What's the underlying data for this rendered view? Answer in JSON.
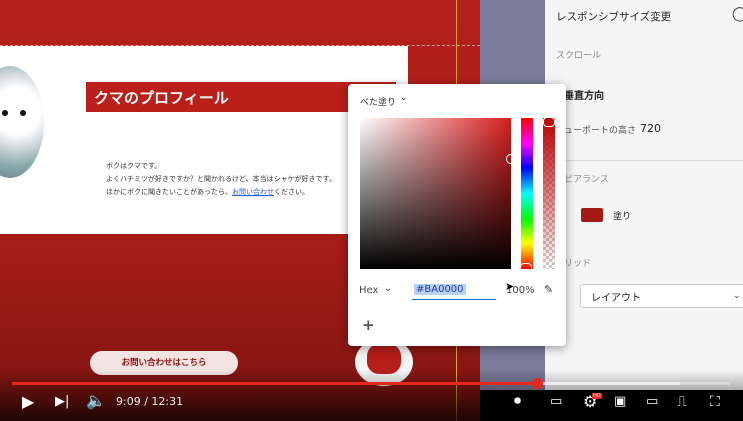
{
  "artboard": {
    "title": "クマのプロフィール",
    "body_lines": [
      "ボクはクマです。",
      "よくハチミツが好きですか？と聞かれるけど、本当はシャケが好きです。",
      "ほかにボクに聞きたいことがあったら、"
    ],
    "link_text": "お問い合わせ",
    "link_suffix": "ください。",
    "contact_button": "お問い合わせはこちら"
  },
  "panel": {
    "responsive_resize": "レスポンシブサイズ変更",
    "scroll_label": "スクロール",
    "scroll_value": "垂直方向",
    "viewport_label": "ューポートの高さ",
    "viewport_value": "720",
    "appearance_label": "ピアランス",
    "fill_label": "塗り",
    "grid_label": "リッド",
    "layout_label": "レイアウト"
  },
  "picker": {
    "fill_type": "べた塗り",
    "mode": "Hex",
    "hex": "#BA0000",
    "opacity_text": "100%",
    "add": "+"
  },
  "player": {
    "time": "9:09 / 12:31",
    "progress_fraction": 0.731,
    "buffered_fraction": 0.93,
    "hd_badge": "HD"
  },
  "colors": {
    "brand_red": "#ba1f1a",
    "picked": "#BA0000",
    "progress": "#e5281d"
  }
}
